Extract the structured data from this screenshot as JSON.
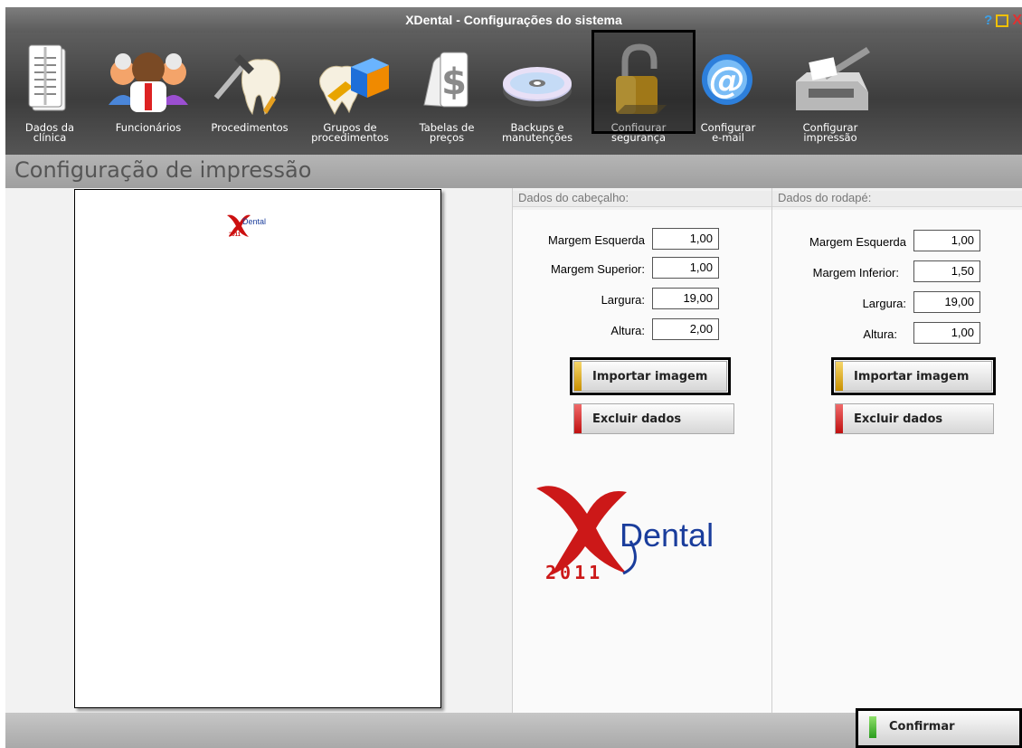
{
  "window": {
    "title": "XDental - Configurações do sistema"
  },
  "title_controls": {
    "help": "?",
    "maximize": "",
    "close": "X"
  },
  "toolbar": {
    "items": [
      {
        "label": "Dados da\nclínica",
        "icon": "document-icon"
      },
      {
        "label": "Funcionários",
        "icon": "people-icon"
      },
      {
        "label": "Procedimentos",
        "icon": "tooth-tool-icon"
      },
      {
        "label": "Grupos de\nprocedimentos",
        "icon": "cubes-icon"
      },
      {
        "label": "Tabelas de\npreços",
        "icon": "price-table-icon"
      },
      {
        "label": "Backups e\nmanutenções",
        "icon": "disc-icon"
      },
      {
        "label": "Configurar\nsegurança",
        "icon": "lock-icon"
      },
      {
        "label": "Configurar\ne-mail",
        "icon": "email-icon"
      },
      {
        "label": "Configurar\nimpressão",
        "icon": "printer-icon"
      }
    ]
  },
  "section": {
    "title": "Configuração de impressão"
  },
  "header_panel": {
    "title": "Dados do cabeçalho:",
    "fields": [
      {
        "label": "Margem Esquerda",
        "value": "1,00"
      },
      {
        "label": "Margem Superior:",
        "value": "1,00"
      },
      {
        "label": "Largura:",
        "value": "19,00"
      },
      {
        "label": "Altura:",
        "value": "2,00"
      }
    ],
    "import_button": "Importar imagem",
    "delete_button": "Excluir dados"
  },
  "footer_panel": {
    "title": "Dados do rodapé:",
    "fields": [
      {
        "label": "Margem Esquerda",
        "value": "1,00"
      },
      {
        "label": "Margem Inferior:",
        "value": "1,50"
      },
      {
        "label": "Largura:",
        "value": "19,00"
      },
      {
        "label": "Altura:",
        "value": "1,00"
      }
    ],
    "import_button": "Importar imagem",
    "delete_button": "Excluir dados"
  },
  "logo": {
    "text": "Dental",
    "year": "2011"
  },
  "bottom": {
    "confirm_button": "Confirmar"
  },
  "colors": {
    "import_swatch": "#d9a400",
    "delete_swatch": "#d41c1c",
    "confirm_swatch": "#3aa82a"
  }
}
